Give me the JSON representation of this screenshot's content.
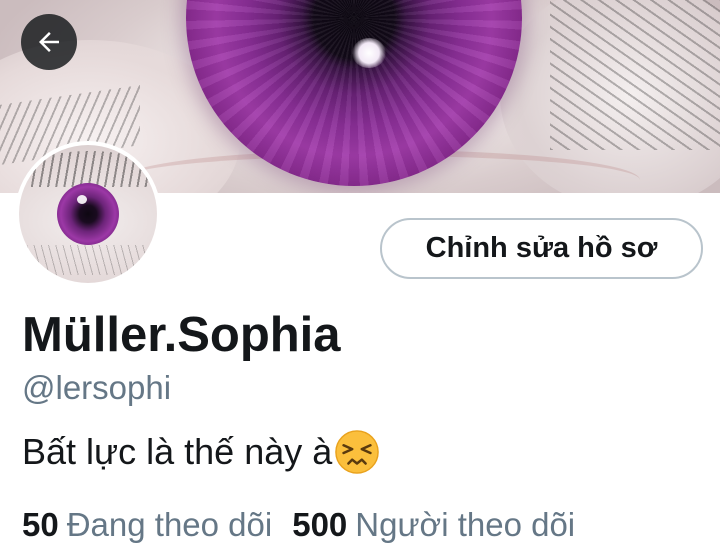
{
  "header": {
    "back_icon": "arrow-left-icon"
  },
  "profile": {
    "display_name": "Müller.Sophia",
    "handle": "@lersophi",
    "bio": "Bất lực là thế này à",
    "bio_emoji": "persevering-face-icon",
    "edit_button_label": "Chỉnh sửa hồ sơ"
  },
  "stats": {
    "following_count": "50",
    "following_label": "Đang theo dõi",
    "followers_count": "500",
    "followers_label": "Người theo dõi"
  },
  "colors": {
    "primary_text": "#14171a",
    "secondary_text": "#657786",
    "button_border": "#b9c4cc",
    "back_button_bg": "#14171a",
    "accent_purple": "#9c38a6"
  }
}
